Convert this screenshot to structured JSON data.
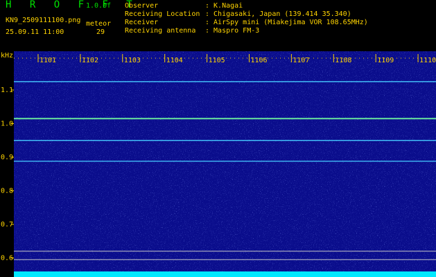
{
  "header": {
    "app_title": "H R O F F T",
    "app_version": "1.0.0f",
    "file_name": "KN9_2509111100.png",
    "meteor_label": "meteor",
    "date_time": "25.09.11 11:00",
    "meteor_count": "29",
    "info": [
      {
        "label": "Observer",
        "value": ": K.Nagai"
      },
      {
        "label": "Receiving Location",
        "value": ": Chigasaki, Japan (139.414 35.340)"
      },
      {
        "label": "Receiver",
        "value": ": AirSpy mini (Miakejima VOR 108.65MHz)"
      },
      {
        "label": "Receiving antenna",
        "value": ": Maspro FM-3"
      }
    ]
  },
  "spectrogram": {
    "y_unit": "kHz",
    "y_ticks": [
      "1.1",
      "1.0",
      "0.9",
      "0.8",
      "0.7",
      "0.6"
    ],
    "x_ticks": [
      "1101",
      "1102",
      "1103",
      "1104",
      "1105",
      "1106",
      "1107",
      "1108",
      "1109",
      "1110"
    ],
    "background_color": "#0a0d8c",
    "signal_lines_khz": [
      1.125,
      1.015,
      0.95,
      0.888
    ],
    "reference_lines_khz": [
      0.62,
      0.595
    ],
    "footer_color": "#00e8ff"
  }
}
